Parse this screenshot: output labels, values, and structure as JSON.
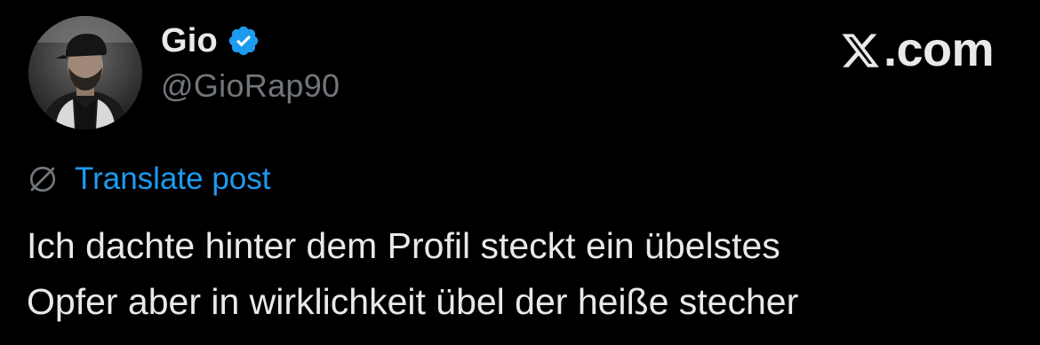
{
  "author": {
    "display_name": "Gio",
    "handle": "@GioRap90",
    "verified": true
  },
  "brand": {
    "label": ".com"
  },
  "translate": {
    "label": "Translate post"
  },
  "post": {
    "lines": [
      "Ich dachte hinter dem Profil steckt ein übelstes",
      "Opfer aber in wirklichkeit übel der heiße stecher"
    ]
  },
  "colors": {
    "background": "#000000",
    "text": "#e7e9ea",
    "muted": "#71767b",
    "link": "#1d9bf0",
    "verified_badge": "#1d9bf0"
  },
  "icons": {
    "verified": "verified-badge-icon",
    "brand": "x-logo-icon",
    "translate": "globe-icon"
  }
}
